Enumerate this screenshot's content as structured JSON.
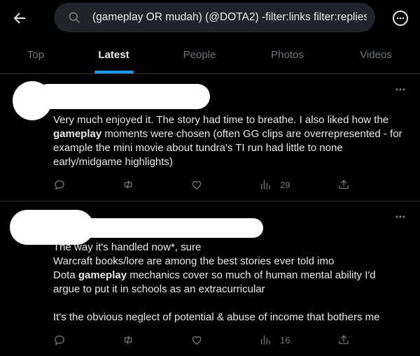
{
  "search": {
    "query": "(gameplay OR mudah) (@DOTA2) -filter:links filter:replies"
  },
  "tabs": [
    {
      "label": "Top"
    },
    {
      "label": "Latest"
    },
    {
      "label": "People"
    },
    {
      "label": "Photos"
    },
    {
      "label": "Videos"
    }
  ],
  "active_tab": "Latest",
  "colors": {
    "accent": "#1d9bf0",
    "background": "#000000",
    "muted": "#71767b",
    "divider": "#2f3336"
  },
  "tweets": [
    {
      "text_before": "Very much enjoyed it. The story had time to breathe. I also liked how the ",
      "highlight": "gameplay",
      "text_after": " moments were chosen (often GG clips are overrepresented - for example the mini movie about tundra's TI run had little to none early/midgame highlights)",
      "views": "29"
    },
    {
      "line1": "The way it's handled now*, sure",
      "line2": "Warcraft books/lore are among the best stories ever told imo",
      "line3_before": "Dota ",
      "highlight": "gameplay",
      "line3_after": " mechanics cover so much of human mental ability I'd argue to put it in schools as an extracurricular",
      "line4": "It's the obvious neglect of potential & abuse of income that bothers me",
      "views": "16"
    }
  ],
  "icons": [
    "back-arrow-icon",
    "search-icon",
    "more-icon",
    "reply-icon",
    "retweet-icon",
    "like-icon",
    "views-icon",
    "share-icon"
  ]
}
